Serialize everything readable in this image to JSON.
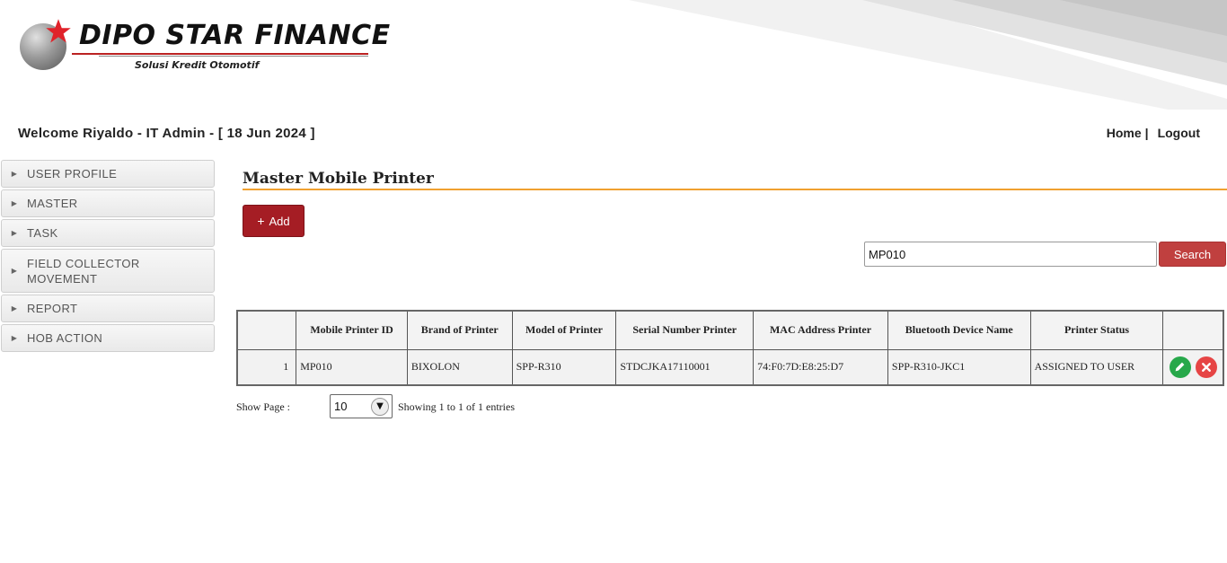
{
  "brand": {
    "name": "DIPO STAR FINANCE",
    "tagline": "Solusi Kredit Otomotif"
  },
  "header": {
    "welcome": "Welcome Riyaldo - IT Admin - [ 18 Jun 2024 ]",
    "home_link": "Home",
    "separator": "|",
    "logout_link": "Logout"
  },
  "sidebar": {
    "items": [
      {
        "label": "USER PROFILE"
      },
      {
        "label": "MASTER"
      },
      {
        "label": "TASK"
      },
      {
        "label": "FIELD COLLECTOR MOVEMENT"
      },
      {
        "label": "REPORT"
      },
      {
        "label": "HOB ACTION"
      }
    ]
  },
  "main": {
    "title": "Master Mobile Printer",
    "add_button": "Add",
    "add_icon": "+",
    "search_value": "MP010",
    "search_button": "Search"
  },
  "table": {
    "columns": [
      "",
      "Mobile Printer ID",
      "Brand of Printer",
      "Model of Printer",
      "Serial Number Printer",
      "MAC Address Printer",
      "Bluetooth Device Name",
      "Printer Status",
      ""
    ],
    "rows": [
      {
        "no": "1",
        "id": "MP010",
        "brand": "BIXOLON",
        "model": "SPP-R310",
        "serial": "STDCJKA17110001",
        "mac": "74:F0:7D:E8:25:D7",
        "bt_name": "SPP-R310-JKC1",
        "status": "ASSIGNED TO USER"
      }
    ]
  },
  "pager": {
    "label": "Show Page :",
    "page_size": "10",
    "info": "Showing 1 to 1 of 1 entries"
  },
  "icons": {
    "edit": "pencil-icon",
    "delete": "close-icon",
    "dropdown": "chevron-down-icon"
  },
  "colors": {
    "brand_red": "#a51d24",
    "search_red": "#c0403f",
    "accent_orange": "#f0a030",
    "edit_green": "#27a84a",
    "delete_red": "#e64545"
  }
}
